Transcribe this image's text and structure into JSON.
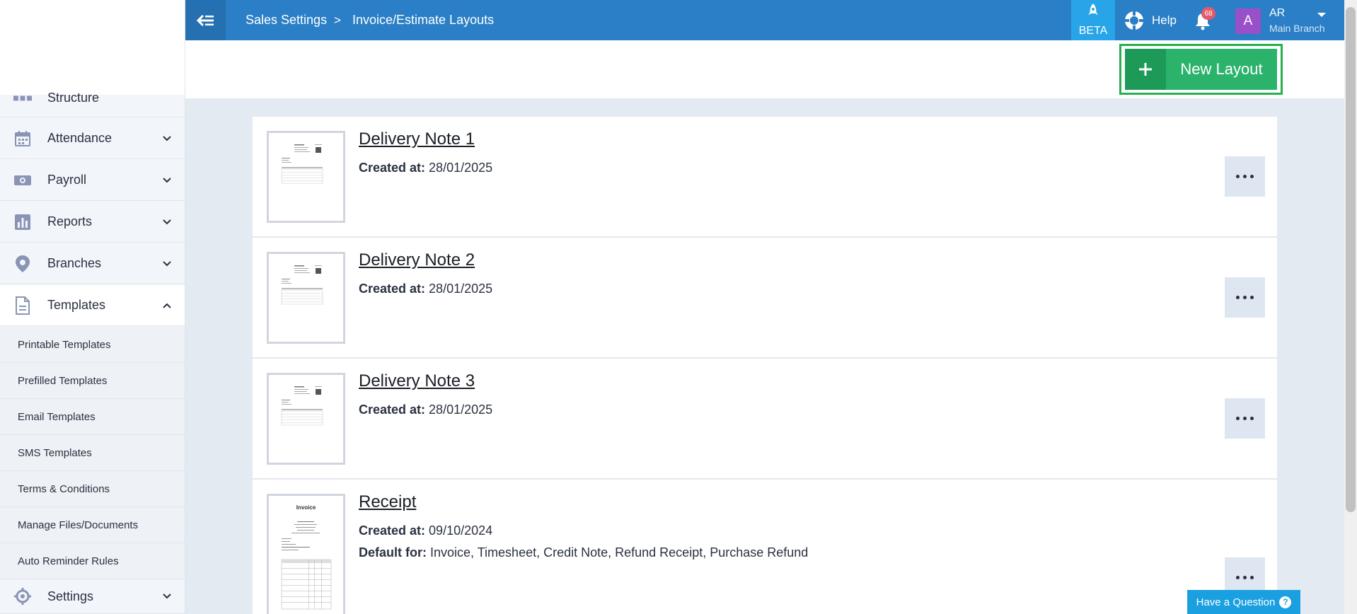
{
  "topbar": {
    "breadcrumb": [
      "Sales Settings",
      "Invoice/Estimate Layouts"
    ],
    "breadcrumb_separator": ">",
    "beta_label": "BETA",
    "help_label": "Help",
    "notification_count": "68",
    "user_initial": "A",
    "user_name": "AR",
    "user_branch": "Main Branch",
    "color": "#2a7fc6"
  },
  "sidebar": {
    "items": [
      {
        "label": "Structure",
        "icon": "structure-icon"
      },
      {
        "label": "Attendance",
        "icon": "calendar-icon"
      },
      {
        "label": "Payroll",
        "icon": "money-icon"
      },
      {
        "label": "Reports",
        "icon": "bar-chart-icon"
      },
      {
        "label": "Branches",
        "icon": "map-pin-icon"
      },
      {
        "label": "Templates",
        "icon": "document-icon"
      },
      {
        "label": "Settings",
        "icon": "gear-icon"
      }
    ],
    "templates_submenu": [
      "Printable Templates",
      "Prefilled Templates",
      "Email Templates",
      "SMS Templates",
      "Terms & Conditions",
      "Manage Files/Documents",
      "Auto Reminder Rules"
    ]
  },
  "actions": {
    "new_layout_label": "New Layout",
    "new_layout_color": "#2bb36c"
  },
  "layouts": [
    {
      "title": "Delivery Note 1",
      "created_label": "Created at:",
      "created": "28/01/2025"
    },
    {
      "title": "Delivery Note 2",
      "created_label": "Created at:",
      "created": "28/01/2025"
    },
    {
      "title": "Delivery Note 3",
      "created_label": "Created at:",
      "created": "28/01/2025"
    },
    {
      "title": "Receipt",
      "created_label": "Created at:",
      "created": "09/10/2024",
      "default_label": "Default for:",
      "default_for": "Invoice, Timesheet, Credit Note, Refund Receipt, Purchase Refund",
      "thumb_heading": "Invoice"
    }
  ],
  "help_widget": {
    "label": "Have a Question",
    "icon_glyph": "?"
  }
}
